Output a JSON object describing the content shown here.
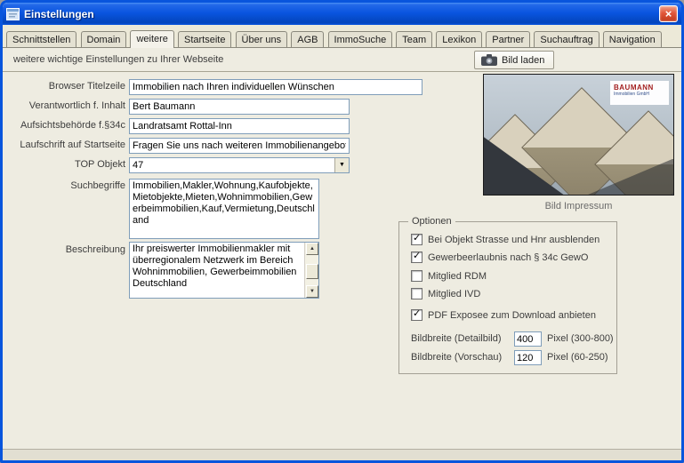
{
  "window": {
    "title": "Einstellungen"
  },
  "icons": {
    "close": "×",
    "dropdown": "▼",
    "scroll_up": "▲",
    "scroll_down": "▼",
    "check": "✓"
  },
  "tabs": [
    {
      "label": "Schnittstellen",
      "active": false
    },
    {
      "label": "Domain",
      "active": false
    },
    {
      "label": "weitere",
      "active": true
    },
    {
      "label": "Startseite",
      "active": false
    },
    {
      "label": "Über uns",
      "active": false
    },
    {
      "label": "AGB",
      "active": false
    },
    {
      "label": "ImmoSuche",
      "active": false
    },
    {
      "label": "Team",
      "active": false
    },
    {
      "label": "Lexikon",
      "active": false
    },
    {
      "label": "Partner",
      "active": false
    },
    {
      "label": "Suchauftrag",
      "active": false
    },
    {
      "label": "Navigation",
      "active": false
    }
  ],
  "header": {
    "subtitle": "weitere wichtige Einstellungen zu Ihrer Webseite",
    "load_image_button": "Bild laden"
  },
  "form": {
    "browser_title": {
      "label": "Browser Titelzeile",
      "value": "Immobilien nach Ihren individuellen Wünschen"
    },
    "responsible": {
      "label": "Verantwortlich f. Inhalt",
      "value": "Bert Baumann"
    },
    "authority": {
      "label": "Aufsichtsbehörde f.§34c",
      "value": "Landratsamt Rottal-Inn"
    },
    "ticker": {
      "label": "Laufschrift auf Startseite",
      "value": "Fragen Sie uns nach weiteren Immobilienangebote"
    },
    "top_object": {
      "label": "TOP Objekt",
      "value": "47"
    },
    "keywords": {
      "label": "Suchbegriffe",
      "value": "Immobilien,Makler,Wohnung,Kaufobjekte,Mietobjekte,Mieten,Wohnimmobilien,Gewerbeimmobilien,Kauf,Vermietung,Deutschland"
    },
    "description": {
      "label": "Beschreibung",
      "value": "Ihr preiswerter Immobilienmakler mit überregionalem Netzwerk im Bereich Wohnimmobilien, Gewerbeimmobilien Deutschland"
    }
  },
  "image_panel": {
    "caption": "Bild Impressum",
    "watermark_line1": "BAUMANN",
    "watermark_line2": "Immobilien GmbH"
  },
  "options": {
    "title": "Optionen",
    "checkboxes": [
      {
        "label": "Bei Objekt Strasse und Hnr ausblenden",
        "checked": true
      },
      {
        "label": "Gewerbeerlaubnis nach § 34c GewO",
        "checked": true
      },
      {
        "label": "Mitglied RDM",
        "checked": false
      },
      {
        "label": "Mitglied IVD",
        "checked": false
      },
      {
        "label": "PDF Exposee zum Download anbieten",
        "checked": true
      }
    ],
    "image_widths": [
      {
        "label": "Bildbreite (Detailbild)",
        "value": "400",
        "hint": "Pixel (300-800)"
      },
      {
        "label": "Bildbreite (Vorschau)",
        "value": "120",
        "hint": "Pixel (60-250)"
      }
    ]
  }
}
